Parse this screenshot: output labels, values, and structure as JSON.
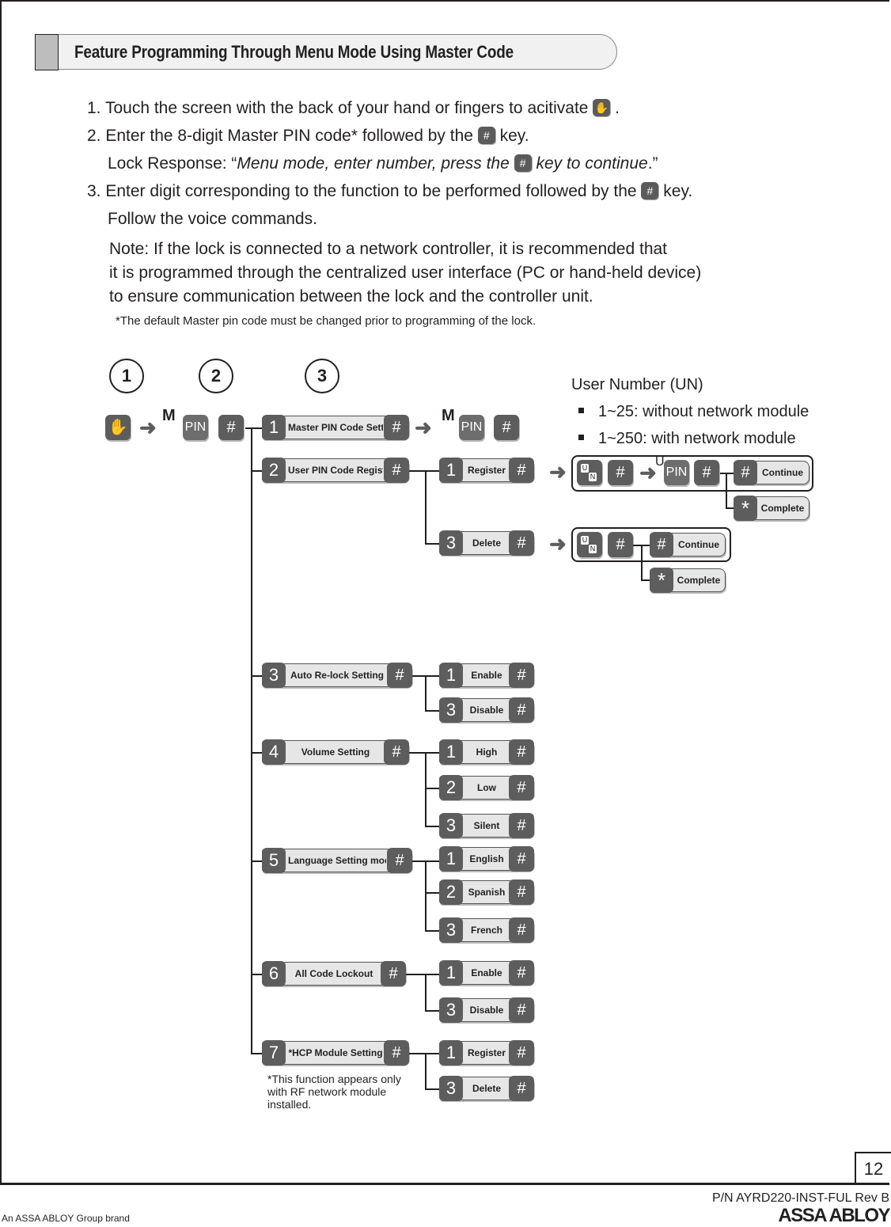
{
  "header": {
    "title": "Feature Programming Through Menu Mode Using Master Code"
  },
  "steps": [
    {
      "pre": "1. Touch the screen with the back of your hand or fingers to acitivate",
      "icon": "hand-icon",
      "post": " ."
    },
    {
      "pre": "2. Enter the 8-digit Master PIN code* followed by the",
      "icon": "hash-key-icon",
      "post": " key."
    },
    {
      "pre": "Lock Response: “",
      "italic_pre": "Menu mode, enter number, press the",
      "icon": "hash-key-icon",
      "italic_post": " key to continue",
      "post": ".”"
    },
    {
      "pre": "3. Enter digit corresponding to the function to be performed followed by the",
      "icon": "hash-key-icon",
      "post": " key."
    },
    {
      "pre": "Follow the voice commands."
    }
  ],
  "note": [
    "Note: If the lock is connected to a network controller, it is recommended that",
    "it is programmed through the centralized user interface (PC or hand-held device)",
    "to ensure communication between the lock and the controller unit."
  ],
  "default_note": "*The default Master pin code must be changed prior to programming of the lock.",
  "diagram": {
    "step_circles": [
      "1",
      "2",
      "3"
    ],
    "m_label": "M",
    "u_label": "U",
    "pin_label": "PIN",
    "hash": "#",
    "star": "*",
    "un_u": "U",
    "un_n": "N",
    "user_number": {
      "title": "User Number (UN)",
      "items": [
        "1~25: without network module",
        "1~250: with network module"
      ]
    },
    "menu": [
      {
        "num": "1",
        "label": "Master PIN Code Setting",
        "options": []
      },
      {
        "num": "2",
        "label": "User PIN Code Registration",
        "options": [
          {
            "num": "1",
            "label": "Register"
          },
          {
            "num": "3",
            "label": "Delete"
          }
        ]
      },
      {
        "num": "3",
        "label": "Auto Re-lock Setting",
        "options": [
          {
            "num": "1",
            "label": "Enable"
          },
          {
            "num": "3",
            "label": "Disable"
          }
        ]
      },
      {
        "num": "4",
        "label": "Volume Setting",
        "options": [
          {
            "num": "1",
            "label": "High"
          },
          {
            "num": "2",
            "label": "Low"
          },
          {
            "num": "3",
            "label": "Silent"
          }
        ]
      },
      {
        "num": "5",
        "label": "Language Setting mode",
        "options": [
          {
            "num": "1",
            "label": "English"
          },
          {
            "num": "2",
            "label": "Spanish"
          },
          {
            "num": "3",
            "label": "French"
          }
        ]
      },
      {
        "num": "6",
        "label": "All Code Lockout",
        "options": [
          {
            "num": "1",
            "label": "Enable"
          },
          {
            "num": "3",
            "label": "Disable"
          }
        ]
      },
      {
        "num": "7",
        "label": "*HCP Module Setting",
        "options": [
          {
            "num": "1",
            "label": "Register"
          },
          {
            "num": "3",
            "label": "Delete"
          }
        ]
      }
    ],
    "continue_label": "Continue",
    "complete_label": "Complete",
    "hcp_note": [
      "*This function appears only",
      "with RF network module",
      "installed."
    ]
  },
  "footer": {
    "page": "12",
    "part_number": "P/N AYRD220-INST-FUL Rev B",
    "group_brand": "An ASSA ABLOY Group brand",
    "logo": "ASSA ABLOY"
  }
}
